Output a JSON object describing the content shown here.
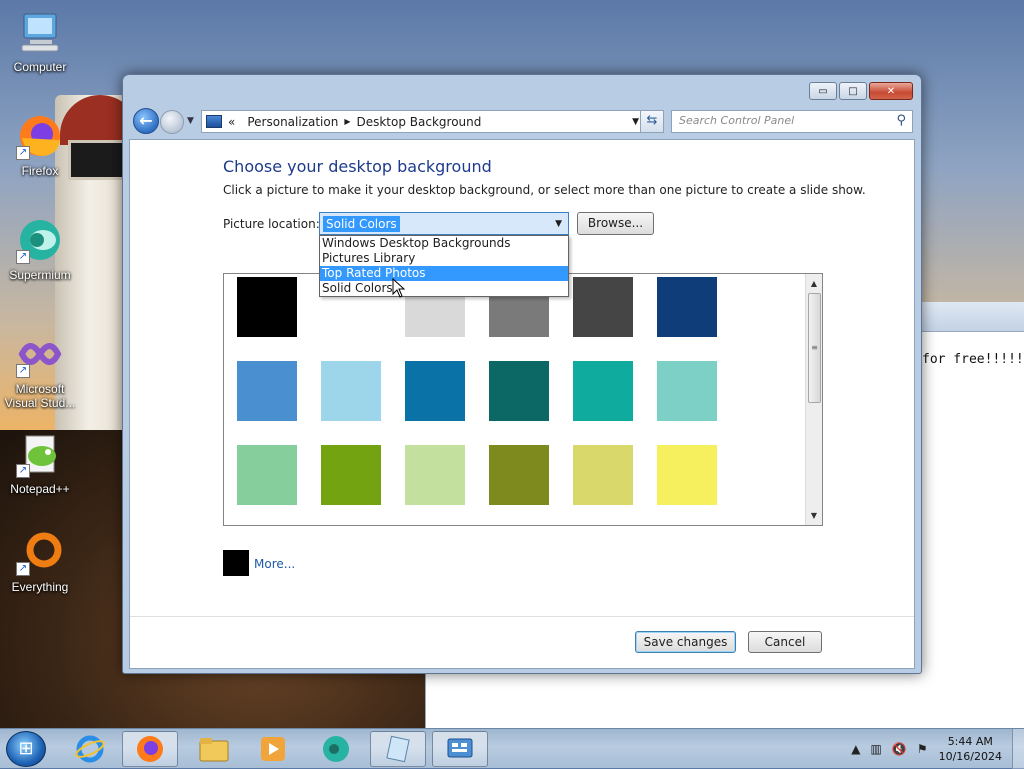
{
  "desktop": {
    "icons": [
      {
        "label": "Computer",
        "icon": "computer-icon"
      },
      {
        "label": "Firefox",
        "icon": "firefox-icon"
      },
      {
        "label": "Supermium",
        "icon": "supermium-icon"
      },
      {
        "label": "Microsoft Visual Stud...",
        "icon": "visual-studio-icon"
      },
      {
        "label": "Notepad++",
        "icon": "notepadpp-icon"
      },
      {
        "label": "Everything",
        "icon": "everything-icon"
      }
    ],
    "background_window_text": "for free!!!!!"
  },
  "window": {
    "caption_buttons": {
      "minimize": "▭",
      "maximize": "□",
      "close": "✕"
    },
    "address": {
      "prefix": "«",
      "crumbs": [
        "Personalization",
        "Desktop Background"
      ],
      "separator": "▶"
    },
    "search": {
      "placeholder": "Search Control Panel"
    }
  },
  "page": {
    "title": "Choose your desktop background",
    "subtitle": "Click a picture to make it your desktop background, or select more than one picture to create a slide show.",
    "picture_location_label": "Picture location:",
    "picture_location_value": "Solid Colors",
    "browse_label": "Browse...",
    "dropdown_options": [
      "Windows Desktop Backgrounds",
      "Pictures Library",
      "Top Rated Photos",
      "Solid Colors"
    ],
    "highlighted_option": "Top Rated Photos",
    "swatches": [
      "#000000",
      "#ffffff",
      "#d9d9d9",
      "#7a7a7a",
      "#454545",
      "#0e3d7a",
      "#4a90d0",
      "#9dd5ea",
      "#0a72a6",
      "#0c6865",
      "#10ab9f",
      "#7dd0c5",
      "#86cf9c",
      "#74a312",
      "#c4e09f",
      "#7f8a1e",
      "#d9d86a",
      "#f6ef5e"
    ],
    "more_swatch_color": "#000000",
    "more_label": "More...",
    "save_label": "Save changes",
    "cancel_label": "Cancel"
  },
  "taskbar": {
    "items": [
      "internet-explorer-icon",
      "firefox-icon",
      "file-explorer-icon",
      "media-player-icon",
      "supermium-icon",
      "notepad-icon",
      "control-panel-icon"
    ],
    "time": "5:44 AM",
    "date": "10/16/2024"
  }
}
